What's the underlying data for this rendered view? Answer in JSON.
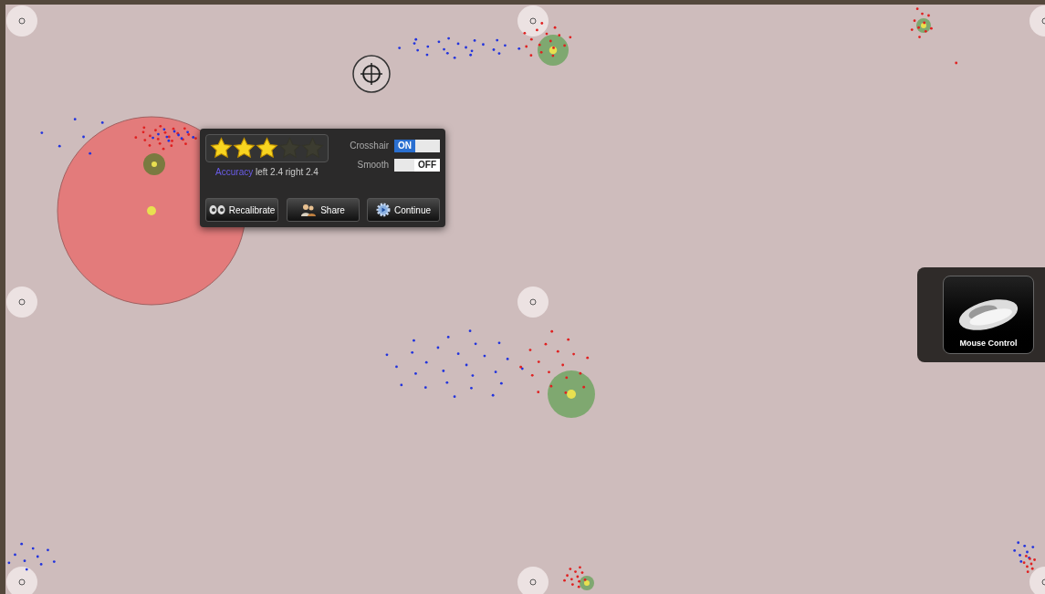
{
  "results": {
    "rating": {
      "stars": 3
    },
    "accuracy": {
      "label": "Accuracy",
      "value": "left 2.4 right 2.4"
    },
    "toggles": [
      {
        "label": "Crosshair",
        "on": true,
        "state_label": "ON"
      },
      {
        "label": "Smooth",
        "on": false,
        "state_label": "OFF"
      }
    ],
    "buttons": [
      {
        "kind": "recalibrate",
        "label": "Recalibrate"
      },
      {
        "kind": "share",
        "label": "Share"
      },
      {
        "kind": "continue",
        "label": "Continue"
      }
    ]
  },
  "side_panel": {
    "tile_label": "Mouse Control"
  }
}
